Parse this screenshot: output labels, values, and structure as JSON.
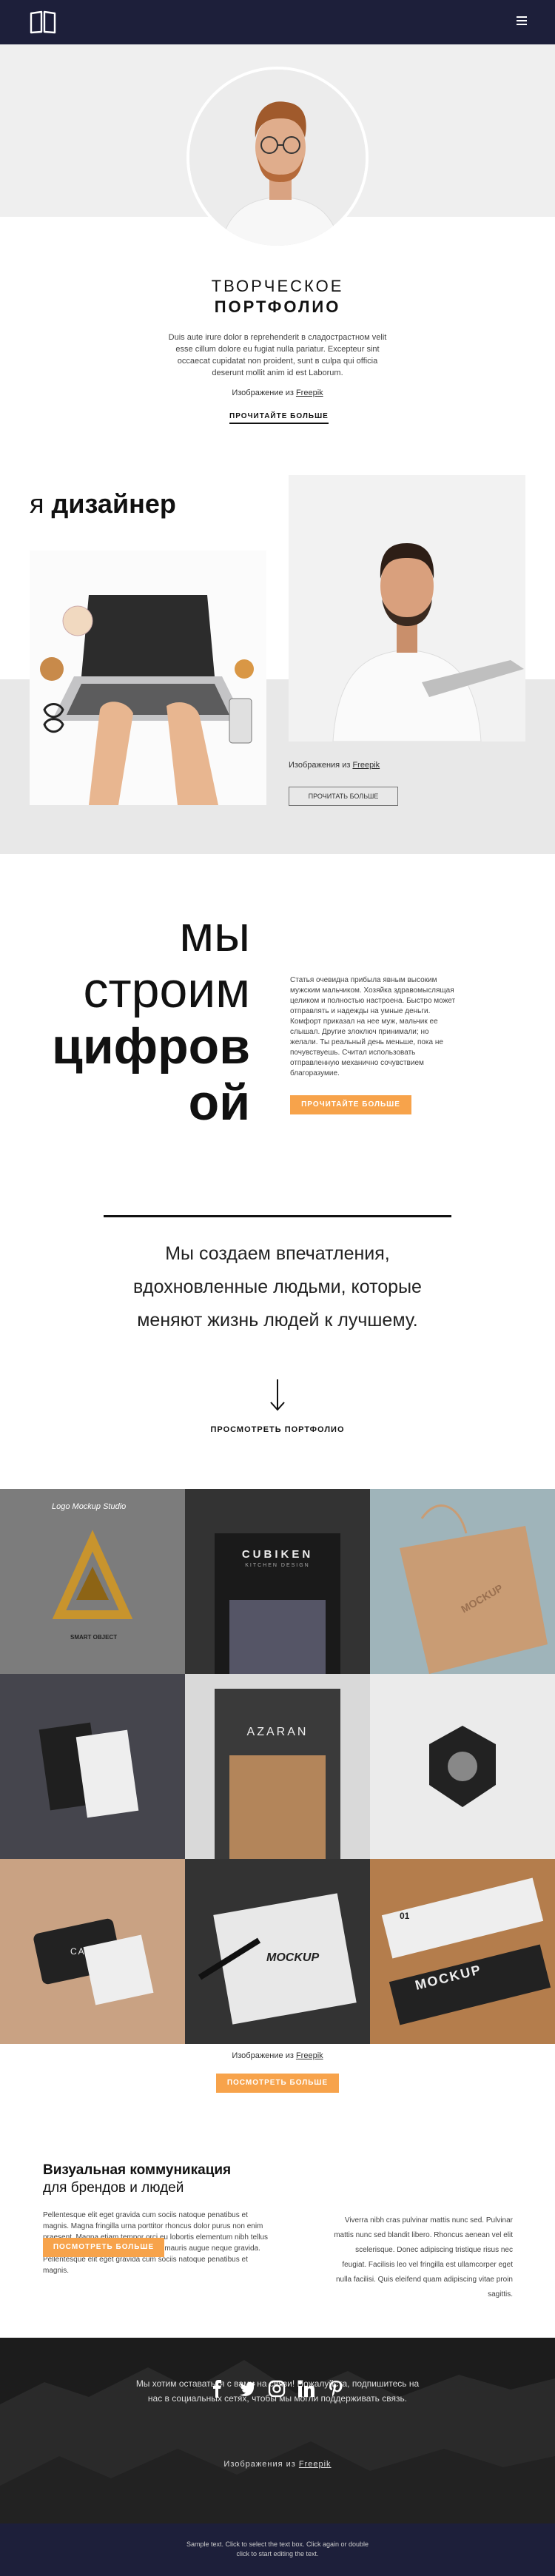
{
  "header": {
    "logo_icon": "book-icon",
    "menu_icon": "hamburger-icon",
    "bg": "#1d1f3a"
  },
  "hero": {
    "title_line1": "ТВОРЧЕСКОЕ",
    "title_line2": "ПОРТФОЛИО",
    "text": "Duis aute irure dolor в reprehenderit в сладострастном velit esse cillum dolore eu fugiat nulla pariatur. Excepteur sint occaecat cupidatat non proident, sunt в culpa qui officia deserunt mollit anim id est Laborum.",
    "credit_prefix": "Изображение из",
    "credit_link": "Freepik",
    "button": "ПРОЧИТАЙТЕ БОЛЬШЕ"
  },
  "designer": {
    "title_light": "я",
    "title_bold": "дизайнер",
    "credit_prefix": "Изображения из",
    "credit_link": "Freepik",
    "button": "ПРОЧИТАТЬ БОЛЬШЕ"
  },
  "build": {
    "word1": "мы",
    "word2": "строим",
    "word3": "цифров",
    "word4": "ой",
    "text": "Статья очевидна прибыла явным высоким мужским мальчиком. Хозяйка здравомыслящая целиком и полностью настроена. Быстро может отправлять и надежды на умные деньги. Комфорт приказал на нее муж, мальчик ее слышал. Другие злоключ принимали; но желали. Ты реальный день меньше, пока не почувствуешь. Считал использовать отправленную механично сочувствием благоразумие.",
    "button": "ПРОЧИТАЙТЕ БОЛЬШЕ",
    "accent": "#f7a34b"
  },
  "quote": {
    "text": "Мы создаем впечатления, вдохновленные людьми, которые меняют жизнь людей к лучшему.",
    "arrow_icon": "arrow-down-icon",
    "button": "ПРОСМОТРЕТЬ ПОРТФОЛИО"
  },
  "gallery": {
    "items": [
      {
        "caption": "Logo Mockup Studio",
        "sub": "SMART OBJECT"
      },
      {
        "caption": "CUBIKEN",
        "sub": "KITCHEN DESIGN"
      },
      {
        "caption": "MOCKUP",
        "sub": ""
      },
      {
        "caption": "",
        "sub": ""
      },
      {
        "caption": "AZARAN",
        "sub": ""
      },
      {
        "caption": "",
        "sub": ""
      },
      {
        "caption": "CARD",
        "sub": ""
      },
      {
        "caption": "MOCKUP",
        "sub": ""
      },
      {
        "caption": "MOCKUP",
        "sub": "01"
      }
    ],
    "credit_prefix": "Изображение из",
    "credit_link": "Freepik",
    "button": "ПОСМОТРЕТЬ БОЛЬШЕ"
  },
  "visual": {
    "title": "Визуальная коммуникация",
    "subtitle": "для брендов и людей",
    "text_left": "Pellentesque elit eget gravida cum sociis natoque penatibus et magnis. Magna fringilla urna porttitor rhoncus dolor purus non enim praesent. Magna etiam tempor orci eu lobortis elementum nibh tellus molestie. Tellus orci ac auctor augue mauris augue neque gravida. Pellentesque elit eget gravida cum sociis natoque penatibus et magnis.",
    "button": "ПОСМОТРЕТЬ БОЛЬШЕ",
    "text_right": "Viverra nibh cras pulvinar mattis nunc sed. Pulvinar mattis nunc sed blandit libero. Rhoncus aenean vel elit scelerisque. Donec adipiscing tristique risus nec feugiat. Facilisis leo vel fringilla est ullamcorper eget nulla facilisi. Quis eleifend quam adipiscing vitae proin sagittis."
  },
  "footer_band": {
    "text": "Мы хотим оставаться с вами на связи! Пожалуйста, подпишитесь на нас в социальных сетях, чтобы мы могли поддерживать связь.",
    "icons": [
      "facebook-icon",
      "twitter-icon",
      "instagram-icon",
      "linkedin-icon",
      "pinterest-icon"
    ],
    "credit_prefix": "Изображения из",
    "credit_link": "Freepik"
  },
  "footer": {
    "text1": "Sample text. Click to select the text box. Click again or double",
    "text2": "click to start editing the text."
  }
}
